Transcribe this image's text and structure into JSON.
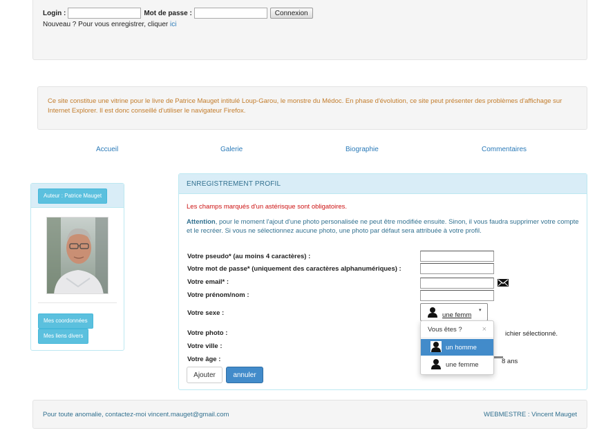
{
  "login": {
    "login_label": "Login :",
    "login_value": "",
    "password_label": "Mot de passe :",
    "password_value": "",
    "connect_button": "Connexion",
    "register_prefix": "Nouveau ? Pour vous enregistrer, cliquer",
    "register_link": "ici"
  },
  "notice": {
    "text": "Ce site constitue une vitrine pour le livre de Patrice Mauget intitulé Loup-Garou, le monstre du Médoc. En phase d'évolution, ce site peut présenter des problèmes d'affichage sur Internet Explorer. Il est donc conseillé d'utiliser le navigateur Firefox."
  },
  "nav": {
    "items": [
      "Accueil",
      "Galerie",
      "Biographie",
      "Commentaires"
    ]
  },
  "author_panel": {
    "author_button": "Auteur : Patrice Mauget",
    "coord_button": "Mes coordonnées",
    "links_button": "Mes liens divers"
  },
  "register": {
    "heading": "ENREGISTREMENT PROFIL",
    "required_note": "Les champs marqués d'un astérisque sont obligatoires.",
    "attention_bold": "Attention",
    "attention_text": ", pour le moment l'ajout d'une photo personalisée ne peut être modifiée ensuite. Sinon, il vous faudra supprimer votre compte et le recréer. Si vous ne sélectionnez aucune photo, une photo par défaut sera attribuée à votre profil.",
    "fields": {
      "pseudo": "Votre pseudo* (au moins 4 caractères) :",
      "password": "Votre mot de passe* (uniquement des caractères alphanumériques) :",
      "email": "Votre email* :",
      "name": "Votre prénom/nom :",
      "sex": "Votre sexe :",
      "photo": "Votre photo :",
      "city": "Votre ville :",
      "age": "Votre âge :"
    },
    "sex_selected": "une femm",
    "file_status": "ichier sélectionné.",
    "age_suffix": "8 ans",
    "add_button": "Ajouter",
    "cancel_button": "annuler"
  },
  "sex_dropdown": {
    "header": "Vous êtes ?",
    "close": "×",
    "options": [
      "un homme",
      "une femme"
    ],
    "active_index": 0
  },
  "footer": {
    "contact": "Pour toute anomalie, contactez-moi vincent.mauget@gmail.com",
    "webmaster": "WEBMESTRE : Vincent Mauget"
  },
  "colors": {
    "link": "#2a7ab8",
    "notice": "#c27c2b",
    "required": "#cc1111",
    "panel_heading_bg": "#d9edf7",
    "primary": "#428bca",
    "info": "#5bc0de"
  }
}
